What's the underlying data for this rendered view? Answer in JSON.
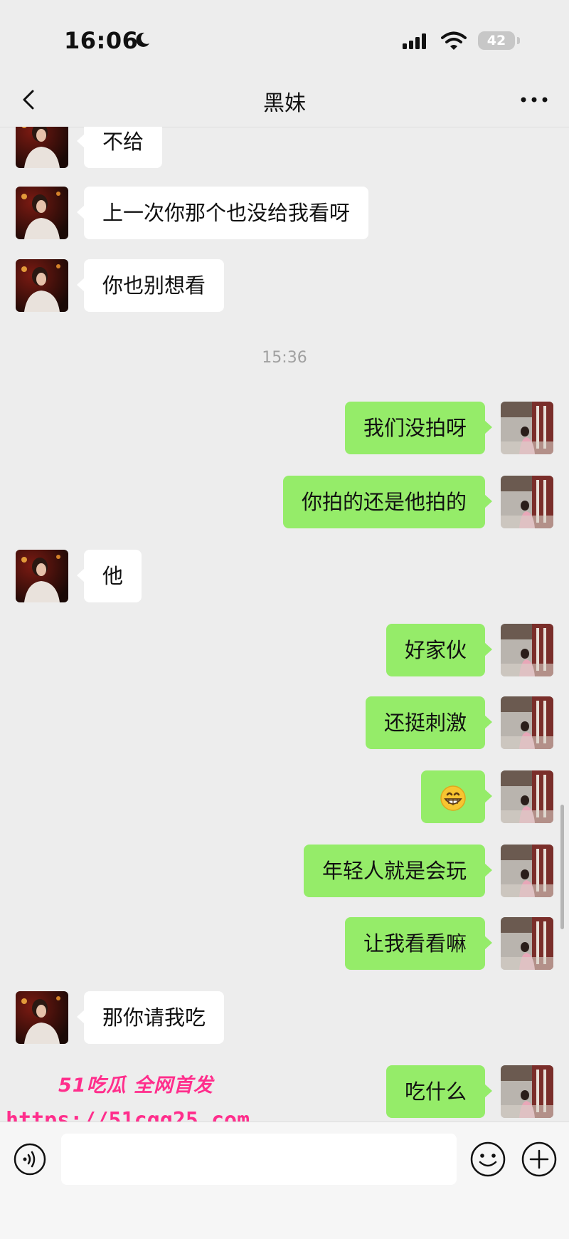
{
  "status_bar": {
    "time": "16:06",
    "battery": "42"
  },
  "header": {
    "title": "黑妹"
  },
  "messages": [
    {
      "side": "in",
      "text": "不给"
    },
    {
      "side": "in",
      "text": "上一次你那个也没给我看呀"
    },
    {
      "side": "in",
      "text": "你也别想看"
    },
    {
      "side": "out",
      "text": "我们没拍呀"
    },
    {
      "side": "out",
      "text": "你拍的还是他拍的"
    },
    {
      "side": "in",
      "text": "他"
    },
    {
      "side": "out",
      "text": "好家伙"
    },
    {
      "side": "out",
      "text": "还挺刺激"
    },
    {
      "side": "out",
      "emoji": "grinning-face-emoji"
    },
    {
      "side": "out",
      "text": "年轻人就是会玩"
    },
    {
      "side": "out",
      "text": "让我看看嘛"
    },
    {
      "side": "in",
      "text": "那你请我吃"
    },
    {
      "side": "out",
      "text": "吃什么"
    }
  ],
  "timestamp": "15:36",
  "watermark": {
    "brand": "51吃瓜 全网首发",
    "url": "https://51cgg25.com"
  },
  "colors": {
    "background": "#ededed",
    "outgoing_bubble": "#95ec69",
    "incoming_bubble": "#ffffff",
    "watermark": "#ff2e8c"
  },
  "icons": {
    "back": "chevron-left-icon",
    "more": "more-dots-icon",
    "voice": "voice-icon",
    "emoji": "emoji-icon",
    "plus": "plus-icon",
    "moon": "moon-icon",
    "signal": "signal-icon",
    "wifi": "wifi-icon"
  }
}
